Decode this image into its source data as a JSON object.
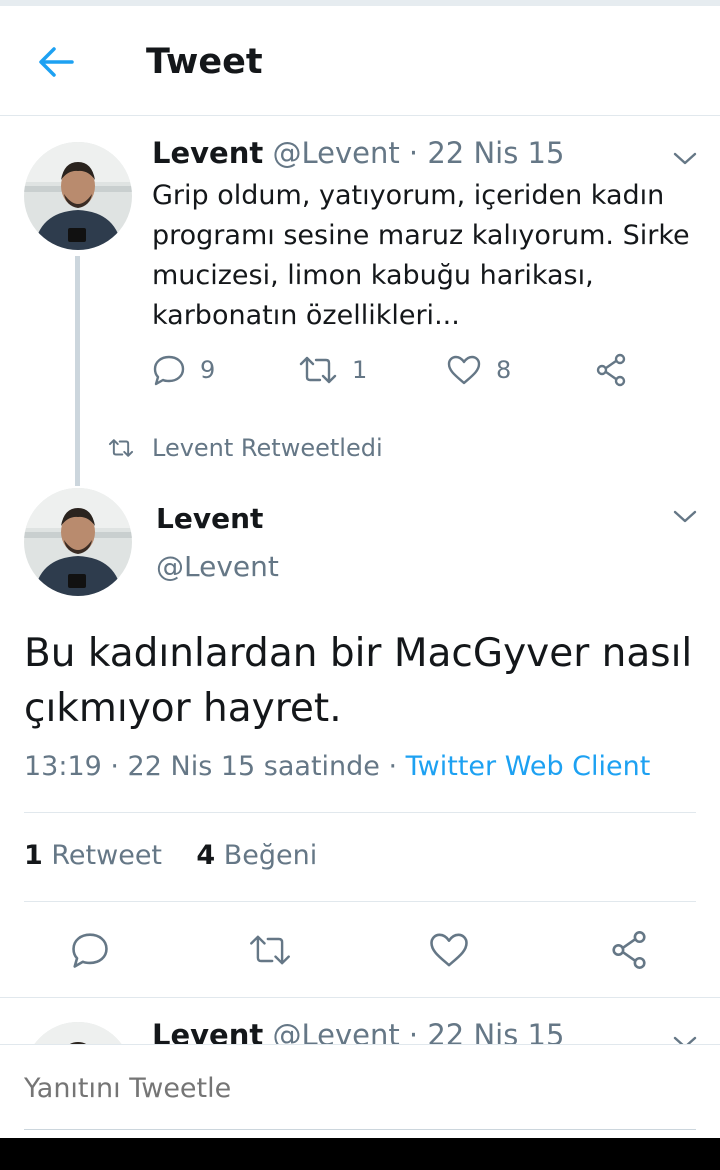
{
  "header": {
    "title": "Tweet",
    "back_icon": "arrow-left-icon"
  },
  "colors": {
    "accent": "#1da1f2",
    "secondary_text": "#657786",
    "divider": "#e1e8ed"
  },
  "parent_tweet": {
    "name": "Levent",
    "meta": " @Levent · 22 Nis 15",
    "text": "Grip oldum, yatıyorum, içeriden kadın programı sesine maruz kalıyorum. Sirke mucizesi, limon kabuğu harikası, karbonatın özellikleri...",
    "replies": "9",
    "retweets": "1",
    "likes": "8"
  },
  "retweet_context": {
    "label": "Levent Retweetledi"
  },
  "main_tweet": {
    "name": "Levent",
    "handle": "@Levent",
    "text": "Bu kadınlardan bir MacGyver nasıl çıkmıyor hayret.",
    "time": "13:19 · 22 Nis 15 saatinde · ",
    "client": "Twitter Web Client",
    "stats": {
      "retweet_count": "1",
      "retweet_label": " Retweet",
      "like_count": "4",
      "like_label": " Beğeni"
    }
  },
  "next_tweet": {
    "name": "Levent",
    "meta": " @Levent · 22 Nis 15"
  },
  "reply_box": {
    "placeholder": "Yanıtını Tweetle"
  }
}
